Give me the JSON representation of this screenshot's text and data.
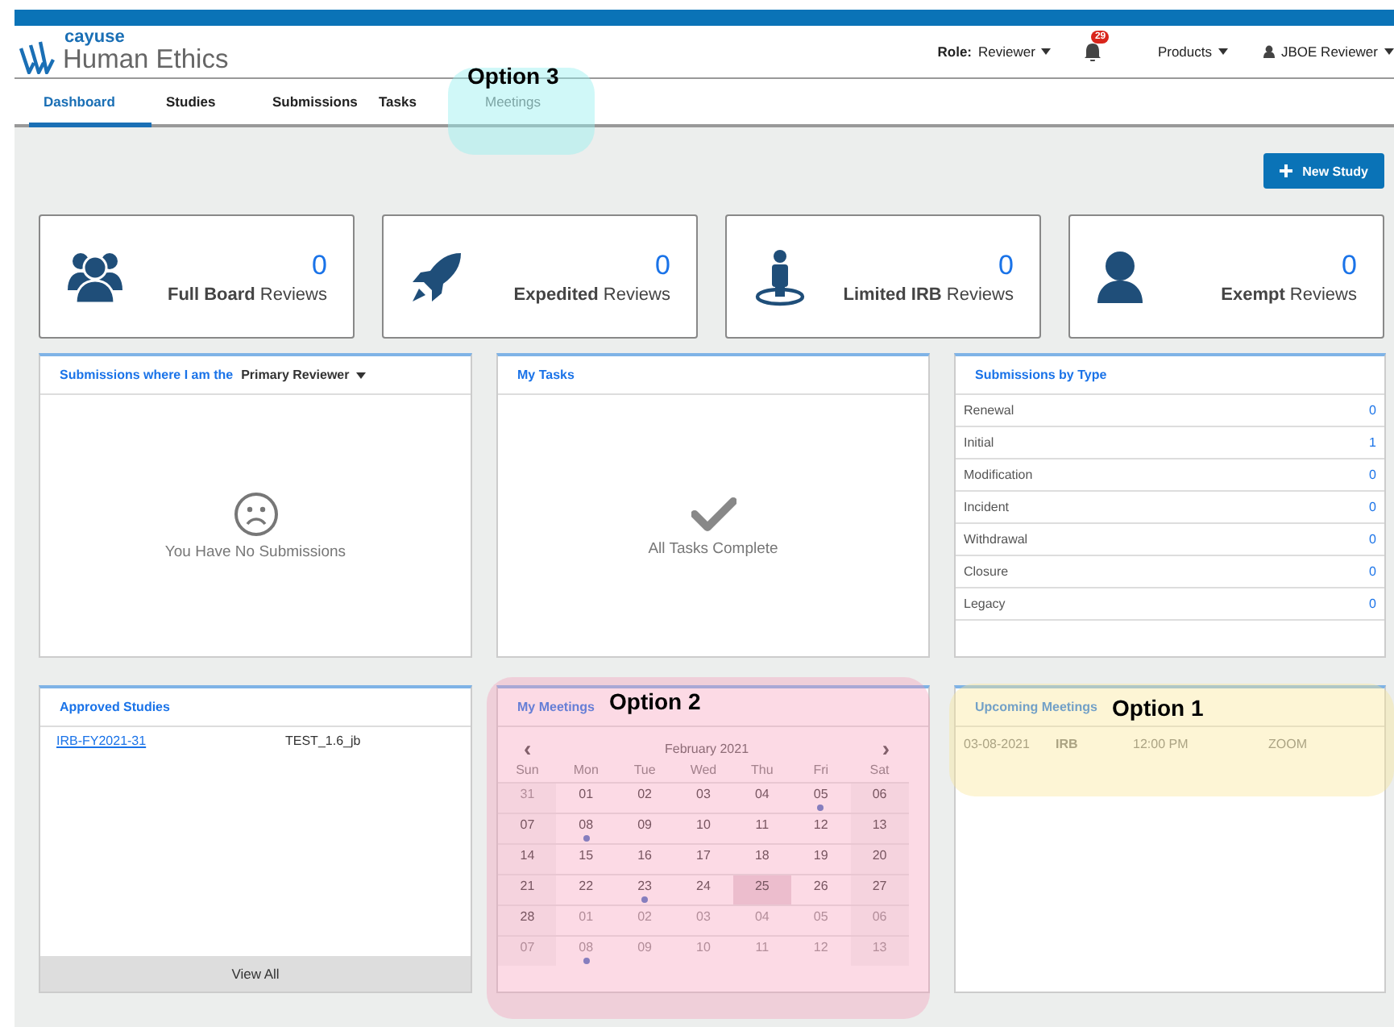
{
  "header": {
    "brand_small": "cayuse",
    "brand_large": "Human Ethics",
    "role_label": "Role:",
    "role_value": "Reviewer",
    "notifications": "29",
    "products": "Products",
    "user": "JBOE Reviewer"
  },
  "tabs": [
    {
      "label": "Dashboard",
      "selected": true
    },
    {
      "label": "Studies",
      "selected": false
    },
    {
      "label": "Submissions",
      "selected": false
    },
    {
      "label": "Tasks",
      "selected": false
    },
    {
      "label": "Meetings",
      "selected": false
    }
  ],
  "new_study_button": "New Study",
  "review_cards": [
    {
      "kind": "group",
      "count": "0",
      "bold": "Full Board",
      "label": "Reviews"
    },
    {
      "kind": "rocket",
      "count": "0",
      "bold": "Expedited",
      "label": "Reviews"
    },
    {
      "kind": "pin",
      "count": "0",
      "bold": "Limited IRB",
      "label": "Reviews"
    },
    {
      "kind": "person",
      "count": "0",
      "bold": "Exempt",
      "label": "Reviews"
    }
  ],
  "submissions_panel": {
    "title": "Submissions where I am the",
    "role_dropdown": "Primary Reviewer",
    "empty_message": "You Have No Submissions"
  },
  "tasks_panel": {
    "title": "My Tasks",
    "empty_message": "All Tasks Complete"
  },
  "by_type_panel": {
    "title": "Submissions by Type",
    "rows": [
      {
        "label": "Renewal",
        "count": "0"
      },
      {
        "label": "Initial",
        "count": "1"
      },
      {
        "label": "Modification",
        "count": "0"
      },
      {
        "label": "Incident",
        "count": "0"
      },
      {
        "label": "Withdrawal",
        "count": "0"
      },
      {
        "label": "Closure",
        "count": "0"
      },
      {
        "label": "Legacy",
        "count": "0"
      }
    ]
  },
  "approved_panel": {
    "title": "Approved Studies",
    "rows": [
      {
        "id": "IRB-FY2021-31",
        "name": "TEST_1.6_jb"
      }
    ],
    "view_all": "View All"
  },
  "meetings_panel": {
    "title": "My Meetings",
    "month": "February 2021",
    "prev": "‹",
    "next": "›",
    "weekdays": [
      "Sun",
      "Mon",
      "Tue",
      "Wed",
      "Thu",
      "Fri",
      "Sat"
    ],
    "weeks": [
      [
        {
          "day": "31",
          "outside": true,
          "event": false,
          "today": false
        },
        {
          "day": "01",
          "outside": false,
          "event": false,
          "today": false
        },
        {
          "day": "02",
          "outside": false,
          "event": false,
          "today": false
        },
        {
          "day": "03",
          "outside": false,
          "event": false,
          "today": false
        },
        {
          "day": "04",
          "outside": false,
          "event": false,
          "today": false
        },
        {
          "day": "05",
          "outside": false,
          "event": true,
          "today": false
        },
        {
          "day": "06",
          "outside": false,
          "event": false,
          "today": false
        }
      ],
      [
        {
          "day": "07",
          "outside": false,
          "event": false,
          "today": false
        },
        {
          "day": "08",
          "outside": false,
          "event": true,
          "today": false
        },
        {
          "day": "09",
          "outside": false,
          "event": false,
          "today": false
        },
        {
          "day": "10",
          "outside": false,
          "event": false,
          "today": false
        },
        {
          "day": "11",
          "outside": false,
          "event": false,
          "today": false
        },
        {
          "day": "12",
          "outside": false,
          "event": false,
          "today": false
        },
        {
          "day": "13",
          "outside": false,
          "event": false,
          "today": false
        }
      ],
      [
        {
          "day": "14",
          "outside": false,
          "event": false,
          "today": false
        },
        {
          "day": "15",
          "outside": false,
          "event": false,
          "today": false
        },
        {
          "day": "16",
          "outside": false,
          "event": false,
          "today": false
        },
        {
          "day": "17",
          "outside": false,
          "event": false,
          "today": false
        },
        {
          "day": "18",
          "outside": false,
          "event": false,
          "today": false
        },
        {
          "day": "19",
          "outside": false,
          "event": false,
          "today": false
        },
        {
          "day": "20",
          "outside": false,
          "event": false,
          "today": false
        }
      ],
      [
        {
          "day": "21",
          "outside": false,
          "event": false,
          "today": false
        },
        {
          "day": "22",
          "outside": false,
          "event": false,
          "today": false
        },
        {
          "day": "23",
          "outside": false,
          "event": true,
          "today": false
        },
        {
          "day": "24",
          "outside": false,
          "event": false,
          "today": false
        },
        {
          "day": "25",
          "outside": false,
          "event": false,
          "today": true
        },
        {
          "day": "26",
          "outside": false,
          "event": false,
          "today": false
        },
        {
          "day": "27",
          "outside": false,
          "event": false,
          "today": false
        }
      ],
      [
        {
          "day": "28",
          "outside": false,
          "event": false,
          "today": false
        },
        {
          "day": "01",
          "outside": true,
          "event": false,
          "today": false
        },
        {
          "day": "02",
          "outside": true,
          "event": false,
          "today": false
        },
        {
          "day": "03",
          "outside": true,
          "event": false,
          "today": false
        },
        {
          "day": "04",
          "outside": true,
          "event": false,
          "today": false
        },
        {
          "day": "05",
          "outside": true,
          "event": false,
          "today": false
        },
        {
          "day": "06",
          "outside": true,
          "event": false,
          "today": false
        }
      ],
      [
        {
          "day": "07",
          "outside": true,
          "event": false,
          "today": false
        },
        {
          "day": "08",
          "outside": true,
          "event": true,
          "today": false
        },
        {
          "day": "09",
          "outside": true,
          "event": false,
          "today": false
        },
        {
          "day": "10",
          "outside": true,
          "event": false,
          "today": false
        },
        {
          "day": "11",
          "outside": true,
          "event": false,
          "today": false
        },
        {
          "day": "12",
          "outside": true,
          "event": false,
          "today": false
        },
        {
          "day": "13",
          "outside": true,
          "event": false,
          "today": false
        }
      ]
    ]
  },
  "upcoming_panel": {
    "title": "Upcoming Meetings",
    "rows": [
      {
        "date": "03-08-2021",
        "committee": "IRB",
        "time": "12:00 PM",
        "location": "ZOOM"
      }
    ]
  },
  "annotations": [
    {
      "kind": "cyan",
      "label": "Option 3"
    },
    {
      "kind": "pink",
      "label": "Option 2"
    },
    {
      "kind": "yellow",
      "label": "Option 1"
    }
  ]
}
